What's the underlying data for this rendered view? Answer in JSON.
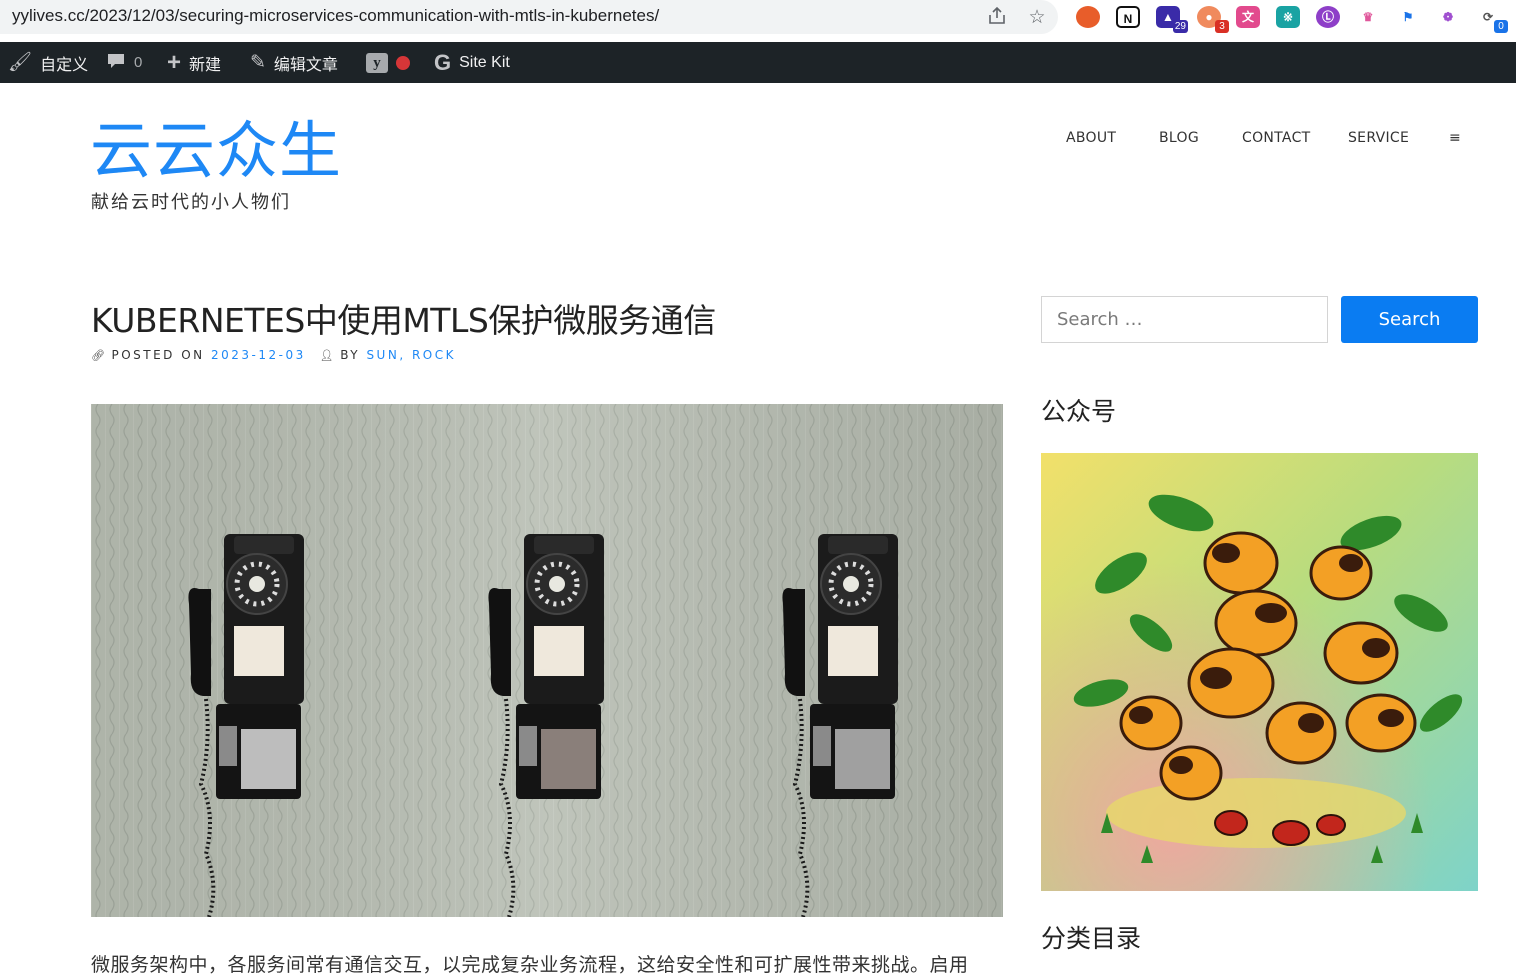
{
  "browser": {
    "url": "yylives.cc/2023/12/03/securing-microservices-communication-with-mtls-in-kubernetes/",
    "extension_badges": [
      "29",
      "3",
      "0"
    ]
  },
  "admin_bar": {
    "customize": "自定义",
    "comments_count": "0",
    "new": "新建",
    "edit_post": "编辑文章",
    "site_kit": "Site Kit"
  },
  "site": {
    "title": "云云众生",
    "description": "献给云时代的小人物们"
  },
  "nav": {
    "items": [
      "ABOUT",
      "BLOG",
      "CONTACT",
      "SERVICE"
    ],
    "menu_icon": "≡"
  },
  "post": {
    "title": "KUBERNETES中使用MTLS保护微服务通信",
    "posted_on_label": "POSTED ON",
    "date": "2023-12-03",
    "by_label": "BY",
    "authors": "SUN, ROCK",
    "first_line": "微服务架构中，各服务间常有通信交互，以完成复杂业务流程，这给安全性和可扩展性带来挑战。启用"
  },
  "sidebar": {
    "search_placeholder": "Search …",
    "search_button": "Search",
    "widget_wechat_title": "公众号",
    "widget_categories_title": "分类目录"
  },
  "colors": {
    "accent": "#1e88f5",
    "button": "#0a7cf2",
    "admin_bar": "#1d2327"
  }
}
